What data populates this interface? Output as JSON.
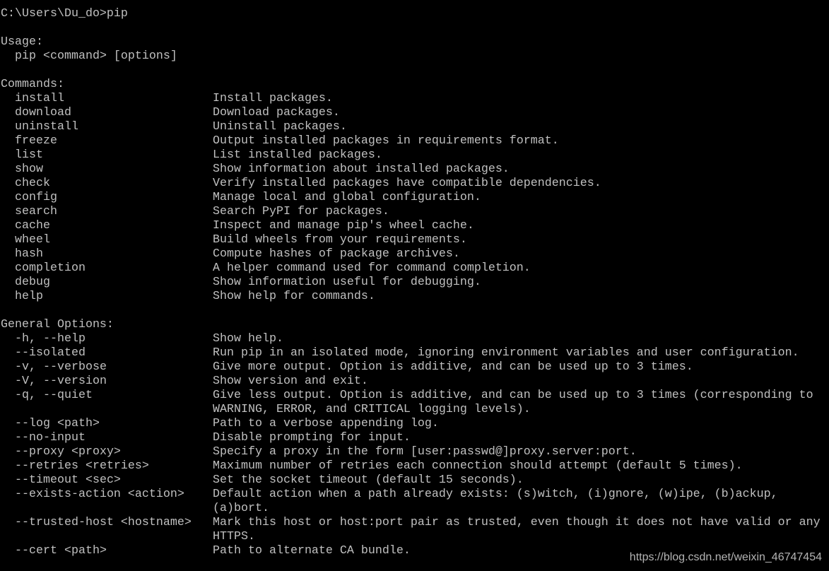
{
  "prompt": "C:\\Users\\Du_do>pip",
  "usage_heading": "Usage:",
  "usage": "pip <command> [options]",
  "commands_heading": "Commands:",
  "commands": [
    {
      "name": "install",
      "desc": [
        "Install packages."
      ]
    },
    {
      "name": "download",
      "desc": [
        "Download packages."
      ]
    },
    {
      "name": "uninstall",
      "desc": [
        "Uninstall packages."
      ]
    },
    {
      "name": "freeze",
      "desc": [
        "Output installed packages in requirements format."
      ]
    },
    {
      "name": "list",
      "desc": [
        "List installed packages."
      ]
    },
    {
      "name": "show",
      "desc": [
        "Show information about installed packages."
      ]
    },
    {
      "name": "check",
      "desc": [
        "Verify installed packages have compatible dependencies."
      ]
    },
    {
      "name": "config",
      "desc": [
        "Manage local and global configuration."
      ]
    },
    {
      "name": "search",
      "desc": [
        "Search PyPI for packages."
      ]
    },
    {
      "name": "cache",
      "desc": [
        "Inspect and manage pip's wheel cache."
      ]
    },
    {
      "name": "wheel",
      "desc": [
        "Build wheels from your requirements."
      ]
    },
    {
      "name": "hash",
      "desc": [
        "Compute hashes of package archives."
      ]
    },
    {
      "name": "completion",
      "desc": [
        "A helper command used for command completion."
      ]
    },
    {
      "name": "debug",
      "desc": [
        "Show information useful for debugging."
      ]
    },
    {
      "name": "help",
      "desc": [
        "Show help for commands."
      ]
    }
  ],
  "options_heading": "General Options:",
  "options": [
    {
      "name": "-h, --help",
      "desc": [
        "Show help."
      ]
    },
    {
      "name": "--isolated",
      "desc": [
        "Run pip in an isolated mode, ignoring environment variables and user configuration."
      ]
    },
    {
      "name": "-v, --verbose",
      "desc": [
        "Give more output. Option is additive, and can be used up to 3 times."
      ]
    },
    {
      "name": "-V, --version",
      "desc": [
        "Show version and exit."
      ]
    },
    {
      "name": "-q, --quiet",
      "desc": [
        "Give less output. Option is additive, and can be used up to 3 times (corresponding to",
        "WARNING, ERROR, and CRITICAL logging levels)."
      ]
    },
    {
      "name": "--log <path>",
      "desc": [
        "Path to a verbose appending log."
      ]
    },
    {
      "name": "--no-input",
      "desc": [
        "Disable prompting for input."
      ]
    },
    {
      "name": "--proxy <proxy>",
      "desc": [
        "Specify a proxy in the form [user:passwd@]proxy.server:port."
      ]
    },
    {
      "name": "--retries <retries>",
      "desc": [
        "Maximum number of retries each connection should attempt (default 5 times)."
      ]
    },
    {
      "name": "--timeout <sec>",
      "desc": [
        "Set the socket timeout (default 15 seconds)."
      ]
    },
    {
      "name": "--exists-action <action>",
      "desc": [
        "Default action when a path already exists: (s)witch, (i)gnore, (w)ipe, (b)ackup,",
        "(a)bort."
      ]
    },
    {
      "name": "--trusted-host <hostname>",
      "desc": [
        "Mark this host or host:port pair as trusted, even though it does not have valid or any",
        "HTTPS."
      ]
    },
    {
      "name": "--cert <path>",
      "desc": [
        "Path to alternate CA bundle."
      ]
    }
  ],
  "watermark": "https://blog.csdn.net/weixin_46747454",
  "colors": {
    "background": "#000000",
    "text": "#c0c0c0"
  }
}
